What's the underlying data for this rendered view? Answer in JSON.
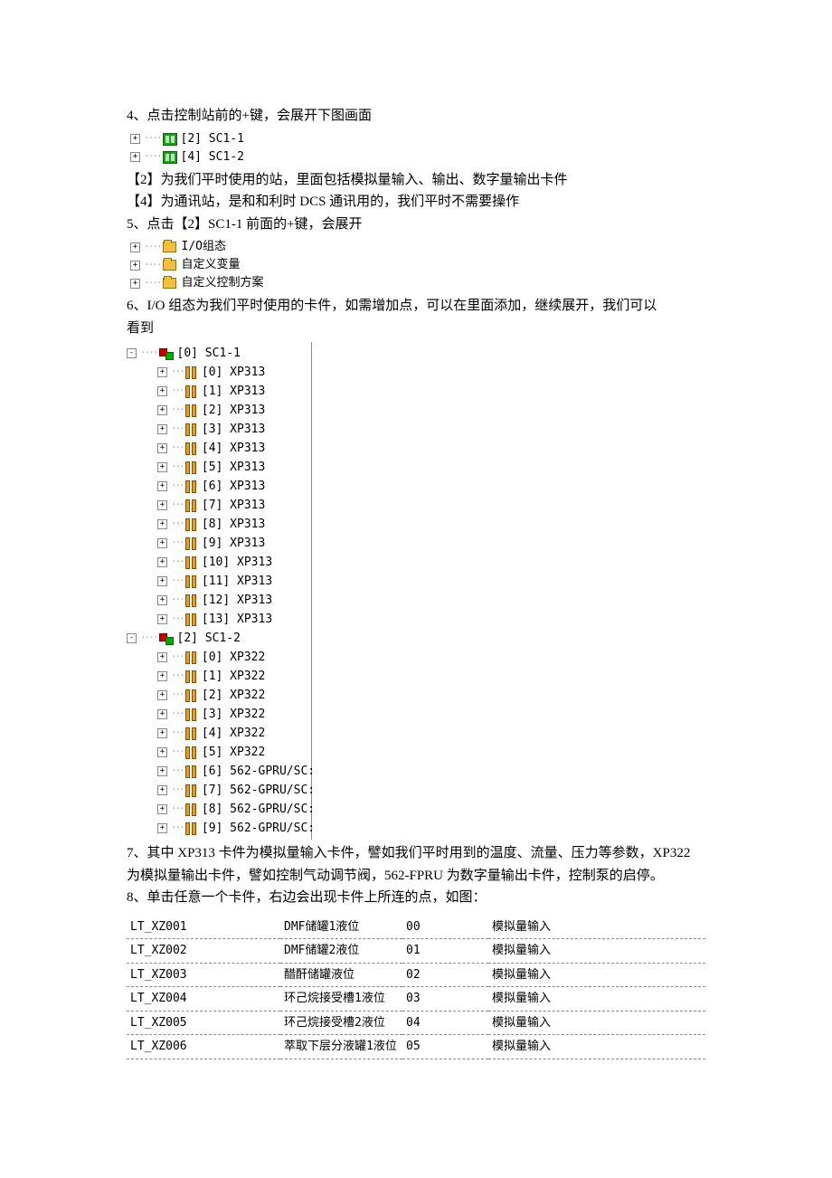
{
  "p1": "4、点击控制站前的+键，会展开下图画面",
  "stations": [
    {
      "label": "[2] SC1-1"
    },
    {
      "label": "[4] SC1-2"
    }
  ],
  "p2": "【2】为我们平时使用的站，里面包括模拟量输入、输出、数字量输出卡件",
  "p3": "【4】为通讯站，是和和利时 DCS 通讯用的，我们平时不需要操作",
  "p4": "5、点击【2】SC1-1 前面的+键，会展开",
  "folders": [
    {
      "label": "I/O组态"
    },
    {
      "label": "自定义变量"
    },
    {
      "label": "自定义控制方案"
    }
  ],
  "p5a": "6、I/O 组态为我们平时使用的卡件，如需增加点，可以在里面添加，继续展开，我们可以",
  "p5b": "看到",
  "sc_groups": [
    {
      "header": "[0] SC1-1",
      "items": [
        "[0] XP313",
        "[1] XP313",
        "[2] XP313",
        "[3] XP313",
        "[4] XP313",
        "[5] XP313",
        "[6] XP313",
        "[7] XP313",
        "[8] XP313",
        "[9] XP313",
        "[10] XP313",
        "[11] XP313",
        "[12] XP313",
        "[13] XP313"
      ]
    },
    {
      "header": "[2] SC1-2",
      "items": [
        "[0] XP322",
        "[1] XP322",
        "[2] XP322",
        "[3] XP322",
        "[4] XP322",
        "[5] XP322",
        "[6] 562-GPRU/SC:",
        "[7] 562-GPRU/SC:",
        "[8] 562-GPRU/SC:",
        "[9] 562-GPRU/SC:"
      ]
    }
  ],
  "p6a": "7、其中 XP313 卡件为模拟量输入卡件，譬如我们平时用到的温度、流量、压力等参数，XP322",
  "p6b": "为模拟量输出卡件，譬如控制气动调节阀，562-FPRU 为数字量输出卡件，控制泵的启停。",
  "p7": "8、单击任意一个卡件，右边会出现卡件上所连的点，如图：",
  "table": [
    {
      "tag": "LT_XZ001",
      "desc": "DMF储罐1液位",
      "ch": "00",
      "type": "模拟量输入"
    },
    {
      "tag": "LT_XZ002",
      "desc": "DMF储罐2液位",
      "ch": "01",
      "type": "模拟量输入"
    },
    {
      "tag": "LT_XZ003",
      "desc": "醋酐储罐液位",
      "ch": "02",
      "type": "模拟量输入"
    },
    {
      "tag": "LT_XZ004",
      "desc": "环己烷接受槽1液位",
      "ch": "03",
      "type": "模拟量输入"
    },
    {
      "tag": "LT_XZ005",
      "desc": "环己烷接受槽2液位",
      "ch": "04",
      "type": "模拟量输入"
    },
    {
      "tag": "LT_XZ006",
      "desc": "萃取下层分液罐1液位",
      "ch": "05",
      "type": "模拟量输入"
    }
  ],
  "plus": "+",
  "minus": "-",
  "dots": "····"
}
